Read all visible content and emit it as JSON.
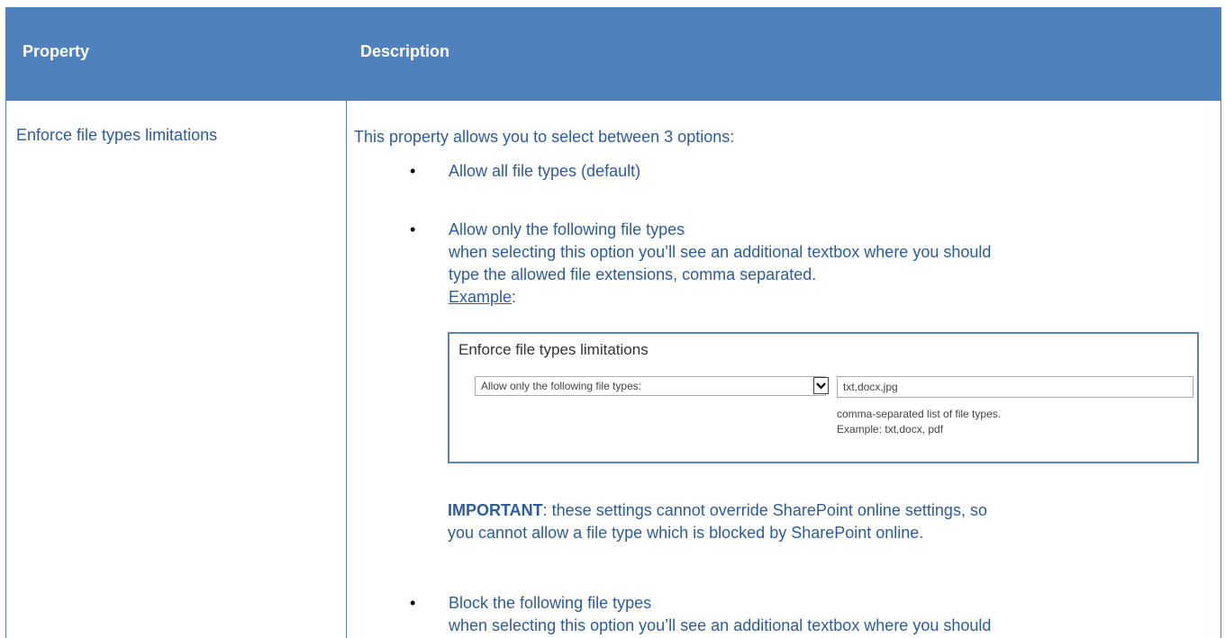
{
  "table": {
    "header": {
      "col1": "Property",
      "col2": "Description"
    },
    "row": {
      "property": "Enforce file types limitations",
      "intro": "This property allows you to select between 3 options:",
      "bullets": [
        {
          "line1": "Allow all file types (default)"
        },
        {
          "line1": "Allow only the following file types",
          "line2": "when selecting this option you’ll see an additional textbox where you should",
          "line3": "type the allowed file extensions, comma separated.",
          "example_label": "Example",
          "example_colon": ":"
        },
        {
          "line1": "Block the following file types",
          "line2": "when selecting this option you’ll see an additional textbox where you should"
        }
      ],
      "example": {
        "title": "Enforce file types limitations",
        "select_value": "Allow only the following file types:",
        "input_value": "txt,docx,jpg",
        "help_line1": "comma-separated list of file types.",
        "help_line2": "Example: txt,docx, pdf"
      },
      "important_label": "IMPORTANT",
      "important_line1": ": these settings cannot override SharePoint online settings, so",
      "important_line2": "you cannot allow a file type which is blocked by SharePoint online."
    }
  },
  "colors": {
    "header_bg": "#4f81bd",
    "header_text": "#ffffff",
    "body_text": "#2e5b99"
  },
  "icons": {
    "bullet": "bullet-dot",
    "dropdown": "chevron-down-icon"
  }
}
